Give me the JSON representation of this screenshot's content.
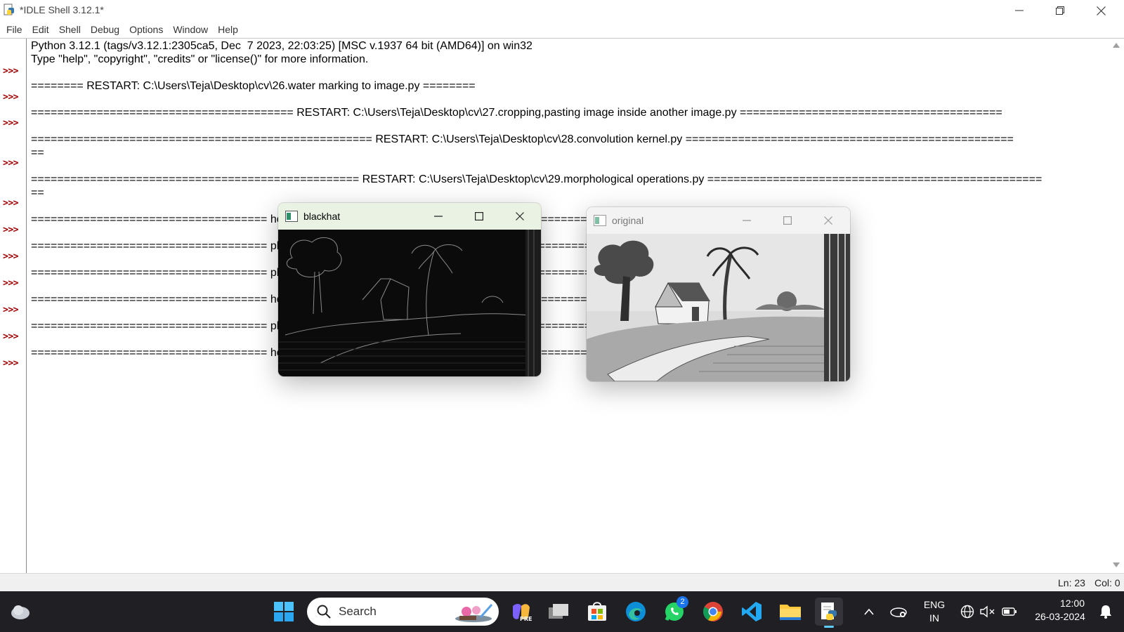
{
  "window": {
    "title": "*IDLE Shell 3.12.1*"
  },
  "menu": [
    "File",
    "Edit",
    "Shell",
    "Debug",
    "Options",
    "Window",
    "Help"
  ],
  "shell": {
    "lines": [
      "Python 3.12.1 (tags/v3.12.1:2305ca5, Dec  7 2023, 22:03:25) [MSC v.1937 64 bit (AMD64)] on win32",
      "Type \"help\", \"copyright\", \"credits\" or \"license()\" for more information.",
      "======== RESTART: C:\\Users\\Teja\\Desktop\\cv\\26.water marking to image.py ========",
      "======================================== RESTART: C:\\Users\\Teja\\Desktop\\cv\\27.cropping,pasting image inside another image.py ========================================",
      "==================================================== RESTART: C:\\Users\\Teja\\Desktop\\cv\\28.convolution kernel.py ==================================================",
      "==",
      "================================================== RESTART: C:\\Users\\Teja\\Desktop\\cv\\29.morphological operations.py ===================================================",
      "==",
      "==================================== hological ==================================================",
      "==================================== phologic ======================================================",
      "==================================== phologic ====================================================",
      "==================================== hological ===================================================",
      "==================================== phologic =====================================================",
      "==================================== hological ==================================================="
    ],
    "prompt": ">>>",
    "prompt_count": 11
  },
  "status": {
    "line": "Ln: 23",
    "col": "Col: 0"
  },
  "windows": {
    "blackhat": {
      "title": "blackhat"
    },
    "original": {
      "title": "original"
    }
  },
  "taskbar": {
    "search_label": "Search",
    "whatsapp_badge": "2",
    "language": "ENG",
    "region": "IN",
    "time": "12:00",
    "date": "26-03-2024"
  },
  "colors": {
    "prompt": "#a00000",
    "taskbar_bg": "#1f1f24",
    "blackhat_bar": "#eaf3e3",
    "original_bar": "#f3f3f3"
  }
}
